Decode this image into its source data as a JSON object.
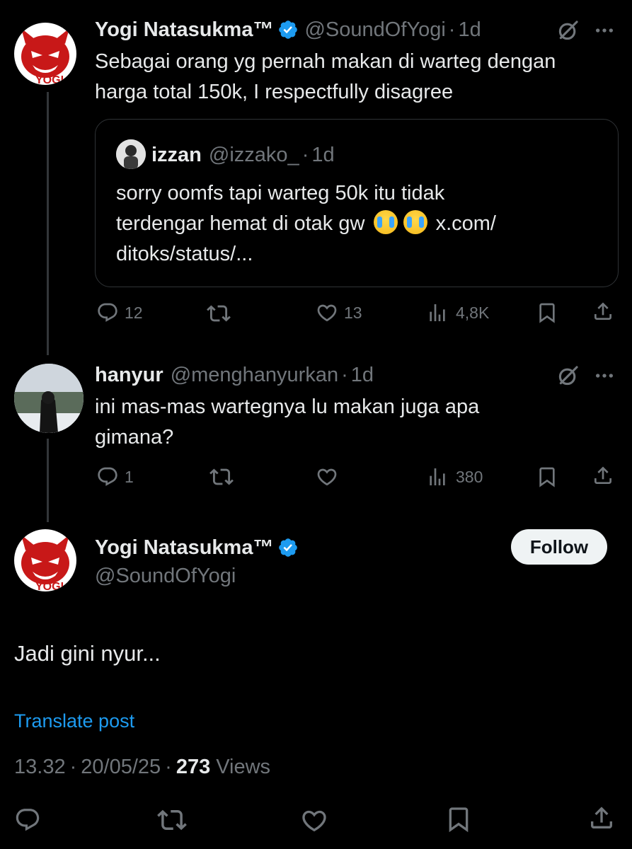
{
  "post1": {
    "name": "Yogi Natasukma™",
    "handle": "@SoundOfYogi",
    "sep": "·",
    "time": "1d",
    "text_line1": "Sebagai orang yg pernah makan di warteg dengan",
    "text_line2": "harga total 150k, I respectfully disagree",
    "quote": {
      "name": "izzan",
      "handle": "@izzako_",
      "time": "1d",
      "line1": "sorry oomfs tapi warteg 50k itu tidak",
      "line2_pre": "terdengar hemat di otak gw",
      "line2_post": "x.com/",
      "line3": "ditoks/status/..."
    },
    "stats": {
      "replies": "12",
      "likes": "13",
      "views": "4,8K"
    }
  },
  "post2": {
    "name": "hanyur",
    "handle": "@menghanyurkan",
    "sep": "·",
    "time": "1d",
    "text_line1": "ini mas-mas wartegnya lu makan juga apa",
    "text_line2": "gimana?",
    "stats": {
      "replies": "1",
      "views": "380"
    }
  },
  "main": {
    "name": "Yogi Natasukma™",
    "handle": "@SoundOfYogi",
    "follow_label": "Follow",
    "text": "Jadi gini nyur...",
    "translate_label": "Translate post",
    "time": "13.32",
    "date": "20/05/25",
    "views_count": "273",
    "views_label": "Views"
  },
  "icons": {
    "reply": "reply-icon",
    "repost": "repost-icon",
    "like": "like-icon",
    "views": "views-icon",
    "bookmark": "bookmark-icon",
    "share": "share-icon",
    "grok": "grok-icon",
    "more": "more-icon",
    "verified": "verified-badge-icon"
  },
  "colors": {
    "background": "#000000",
    "text": "#e7e9ea",
    "muted": "#71767b",
    "link": "#1d9bf0",
    "verified": "#1d9bf0"
  }
}
